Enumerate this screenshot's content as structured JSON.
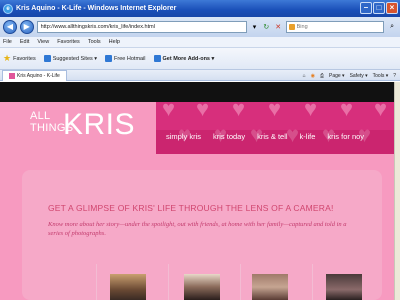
{
  "window": {
    "title": "Kris Aquino - K-Life - Windows Internet Explorer",
    "url": "http://www.allthingskris.com/kris_life/index.html",
    "search_placeholder": "Bing"
  },
  "menu": [
    "File",
    "Edit",
    "View",
    "Favorites",
    "Tools",
    "Help"
  ],
  "links_bar": {
    "favorites": "Favorites",
    "items": [
      "Suggested Sites ▾",
      "Free Hotmail",
      "Get More Add-ons ▾"
    ]
  },
  "tab": {
    "title": "Kris Aquino - K-Life",
    "tools": [
      "Page ▾",
      "Safety ▾",
      "Tools ▾"
    ]
  },
  "site": {
    "logo_all": "ALL",
    "logo_things": "THINGS",
    "logo_kris": "KRIS",
    "nav": [
      "simply kris",
      "kris today",
      "kris & tell",
      "k-life",
      "kris for noy"
    ],
    "headline": "GET A GLIMPSE OF KRIS' LIFE THROUGH THE LENS OF A CAMERA!",
    "subtext": "Know more about her story—under the spotlight, out with friends, at home with her family—captured and told in a series of photographs."
  },
  "colors": {
    "page_pink": "#f79ac0",
    "band_magenta": "#d72f7c",
    "title_bar": "#1a4fb8"
  }
}
